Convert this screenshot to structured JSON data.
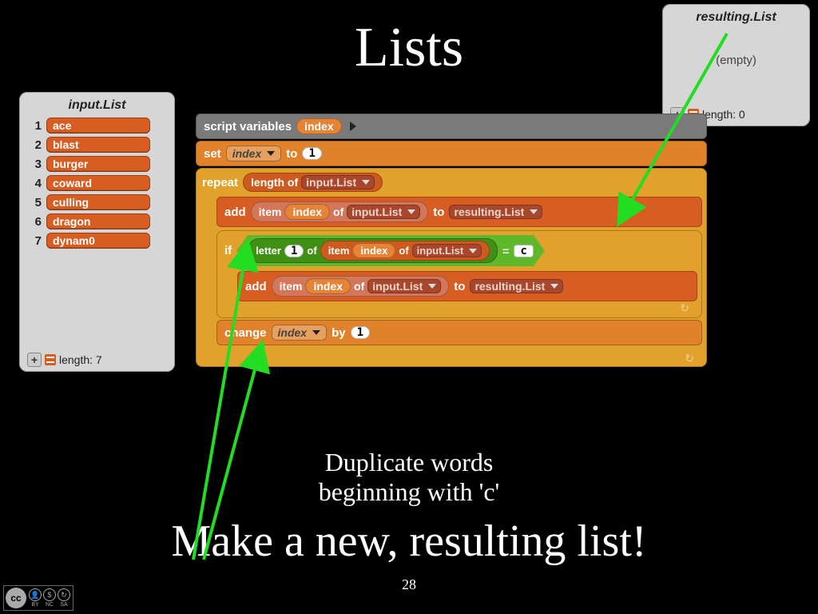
{
  "title": "Lists",
  "subtitle_line1": "Duplicate words",
  "subtitle_line2": "beginning with 'c'",
  "headline": "Make a new, resulting list!",
  "page_number": "28",
  "inputList": {
    "name": "input.List",
    "items": [
      "ace",
      "blast",
      "burger",
      "coward",
      "culling",
      "dragon",
      "dynam0"
    ],
    "length_label": "length: 7"
  },
  "resultingList": {
    "name": "resulting.List",
    "empty_label": "(empty)",
    "length_label": "length: 0"
  },
  "script": {
    "script_vars_label": "script variables",
    "var_name": "index",
    "set_label": "set",
    "to_label": "to",
    "set_value": "1",
    "repeat_label": "repeat",
    "length_of_label": "length of",
    "input_list_ref": "input.List",
    "add_label": "add",
    "item_label": "item",
    "of_label": "of",
    "to2_label": "to",
    "resulting_list_ref": "resulting.List",
    "if_label": "if",
    "letter_label": "letter",
    "letter_idx": "1",
    "equals": "=",
    "letter_c": "c",
    "change_label": "change",
    "by_label": "by",
    "change_amt": "1"
  },
  "cc": {
    "by": "BY",
    "nc": "NC",
    "sa": "SA"
  }
}
